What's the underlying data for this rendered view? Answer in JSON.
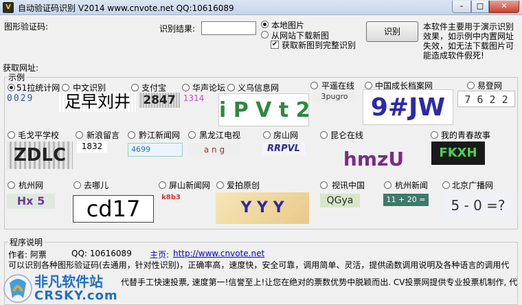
{
  "window": {
    "title": "自动验证码识别 V2014      www.cnvote.net      QQ:10616089",
    "icon_glyph": "V",
    "min": "–",
    "max": "□",
    "close": "✕"
  },
  "top": {
    "captcha_label": "图形验证码:",
    "result_label": "识别结果:",
    "result_value": "",
    "source_local": "本地图片",
    "source_web": "从网站下载新图",
    "fetch_full": "获取新图到完整识别",
    "recognize_button": "识别",
    "notice": "本软件主要用于演示识别效果，如示例中内置网址失效，如无法下载图片可能造成软件假死!",
    "site_label": "获取网址:"
  },
  "examples": {
    "group_title": "示例",
    "row1": [
      {
        "label": "51拉统计网",
        "captcha": "0029",
        "selected": true
      },
      {
        "label": "中文识别",
        "captcha": "足早刘井"
      },
      {
        "label": "支付宝",
        "captcha": "2847"
      },
      {
        "label": "华声论坛",
        "captcha": "1314"
      },
      {
        "label": "义乌信息网",
        "captcha": "i P V t 2"
      },
      {
        "label": "平遥在线",
        "captcha": "3pugro"
      },
      {
        "label": "中国成长档案网",
        "captcha": "9#JW"
      },
      {
        "label": "易登网",
        "captcha": "7 6 2 2"
      }
    ],
    "row2": [
      {
        "label": "毛戈平学校",
        "captcha": "ZDLC"
      },
      {
        "label": "新浪留言",
        "captcha": "1832"
      },
      {
        "label": "黔江新闻网",
        "captcha": "4699"
      },
      {
        "label": "黑龙江电视",
        "captcha": "a n g"
      },
      {
        "label": "房山网",
        "captcha": "RRPVL"
      },
      {
        "label": "昆仑在线",
        "captcha": "hmzU"
      },
      {
        "label": "我的青春故事",
        "captcha": "FKXH"
      }
    ],
    "row3": [
      {
        "label": "杭州网",
        "captcha": "Hx 5"
      },
      {
        "label": "去哪儿",
        "captcha": "cd17"
      },
      {
        "label": "屏山新闻网",
        "captcha": "k8b3"
      },
      {
        "label": "爱拍原创",
        "captcha": "Y Y Y"
      },
      {
        "label": "视讯中国",
        "captcha": "QGya"
      },
      {
        "label": "杭州新闻",
        "captcha": "11 + 20 ="
      },
      {
        "label": "北京广播网",
        "captcha": "5 - 0 =?"
      }
    ]
  },
  "program": {
    "group_title": "程序说明",
    "author_label": "作者: 阿票",
    "qq": "QQ: 10616089",
    "home_label": "主页:",
    "home_url": "http://www.cnvote.net",
    "line1": "可以识别各种图形验证码(去通用，针对性识别)，正确率高，速度快，安全可靠，调用简单、灵活，提供函数调用说明及各种语言的调用代",
    "line2": "代替手工快速投票, 速度第一!信誉至上!让您在绝对的票数优势中脱颖而出. CV投票网提供专业投票机制作, 代理"
  },
  "watermark": {
    "brand": "非凡软件站",
    "domain": "CRSKY.com"
  }
}
